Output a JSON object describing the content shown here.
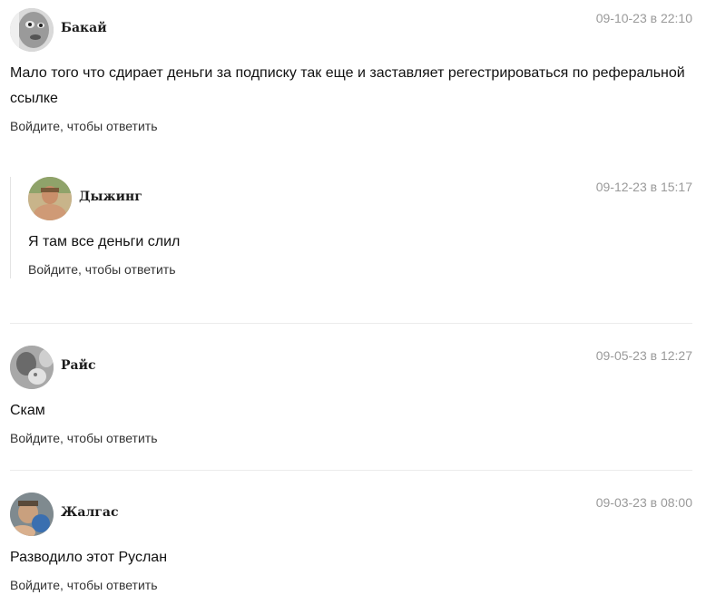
{
  "reply_link_text": "Войдите, чтобы ответить",
  "comments": [
    {
      "author": "Бакай",
      "date": "09-10-23 в 22:10",
      "text": "Мало того что сдирает деньги за подписку так еще и заставляет регестрироваться по реферальной ссылке"
    },
    {
      "author": "Дыжинг",
      "date": "09-12-23 в 15:17",
      "text": "Я там все деньги слил"
    },
    {
      "author": "Райс",
      "date": "09-05-23 в 12:27",
      "text": "Скам"
    },
    {
      "author": "Жалгас",
      "date": "09-03-23 в 08:00",
      "text": "Разводило этот Руслан"
    }
  ],
  "colors": {
    "date": "#9a9a9a",
    "text": "#111111",
    "link": "#333333",
    "divider": "#ececec"
  }
}
